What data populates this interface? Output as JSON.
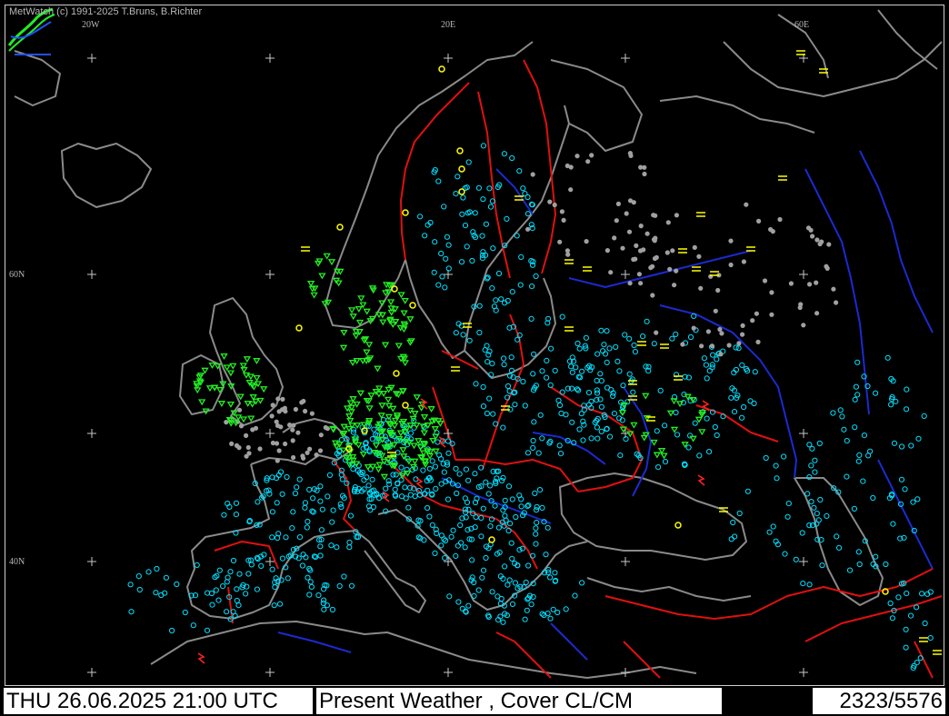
{
  "app": {
    "credit": "MetWatch  (c) 1991-2025 T.Bruns, B.Richter"
  },
  "map": {
    "grid_labels": {
      "lon_20w": "20W",
      "lon_20e": "20E",
      "lon_60e": "60E",
      "lat_60n": "60N",
      "lat_40n": "40N"
    },
    "colors": {
      "coast": "#8a8a8a",
      "borders": "#e01010",
      "rivers": "#1a2bd0",
      "station_cyan": "#00e0ff",
      "station_grey": "#a0a0a0",
      "rain_green": "#22ee22",
      "fog_yellow": "#ffff00",
      "thunder_red": "#ff2020"
    }
  },
  "status_bar": {
    "datetime": "THU 26.06.2025 21:00 UTC",
    "layers": "Present Weather    , Cover CL/CM",
    "count": "2323/5576"
  }
}
